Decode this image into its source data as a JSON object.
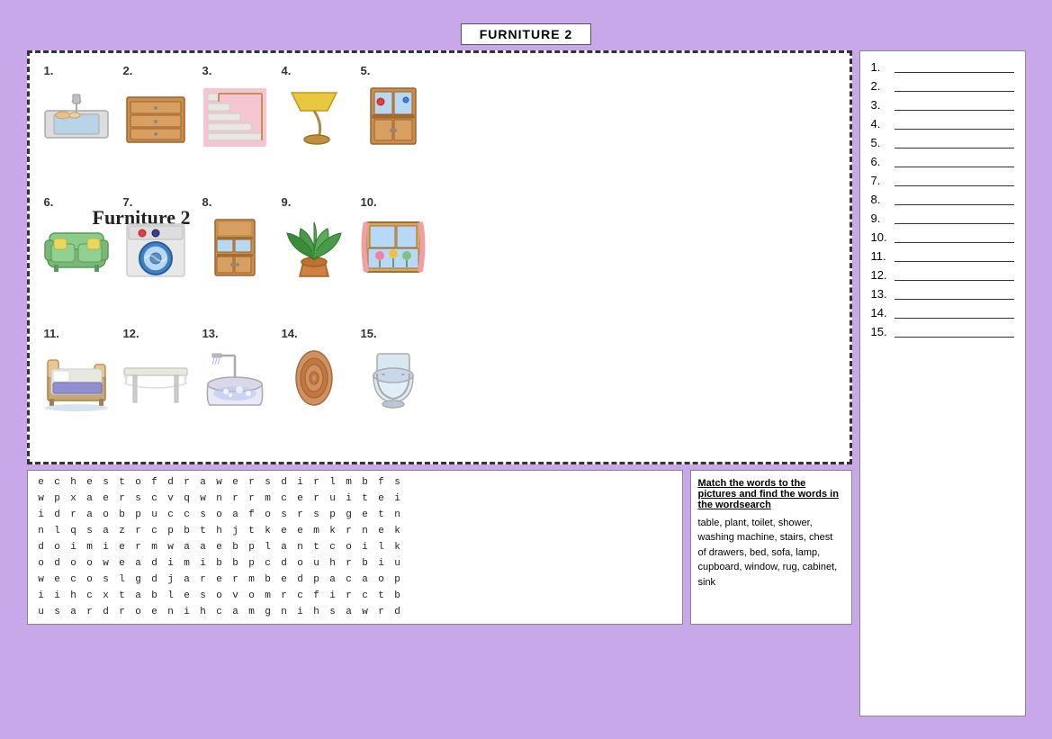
{
  "title": "FURNITURE 2",
  "worksheet_title": "Furniture 2",
  "items": [
    {
      "number": "1.",
      "name": "sink",
      "emoji": "🚿"
    },
    {
      "number": "2.",
      "name": "chest of drawers",
      "emoji": "🗄"
    },
    {
      "number": "3.",
      "name": "stairs",
      "emoji": "🪜"
    },
    {
      "number": "4.",
      "name": "lamp",
      "emoji": "💡"
    },
    {
      "number": "5.",
      "name": "cabinet",
      "emoji": "🗃"
    },
    {
      "number": "6.",
      "name": "sofa",
      "emoji": "🛋"
    },
    {
      "number": "7.",
      "name": "washing machine",
      "emoji": "🫧"
    },
    {
      "number": "8.",
      "name": "cupboard",
      "emoji": "🚪"
    },
    {
      "number": "9.",
      "name": "plant",
      "emoji": "🌿"
    },
    {
      "number": "10.",
      "name": "window",
      "emoji": "🪟"
    },
    {
      "number": "11.",
      "name": "bed",
      "emoji": "🛏"
    },
    {
      "number": "12.",
      "name": "table",
      "emoji": "🪑"
    },
    {
      "number": "13.",
      "name": "shower",
      "emoji": "🚿"
    },
    {
      "number": "14.",
      "name": "rug",
      "emoji": "🔶"
    },
    {
      "number": "15.",
      "name": "toilet",
      "emoji": "🚽"
    }
  ],
  "answers": [
    {
      "num": "1.",
      "line": ""
    },
    {
      "num": "2.",
      "line": ""
    },
    {
      "num": "3.",
      "line": ""
    },
    {
      "num": "4.",
      "line": ""
    },
    {
      "num": "5.",
      "line": ""
    },
    {
      "num": "6.",
      "line": ""
    },
    {
      "num": "7.",
      "line": ""
    },
    {
      "num": "8.",
      "line": ""
    },
    {
      "num": "9.",
      "line": ""
    },
    {
      "num": "10.",
      "line": ""
    },
    {
      "num": "11.",
      "line": ""
    },
    {
      "num": "12.",
      "line": ""
    },
    {
      "num": "13.",
      "line": ""
    },
    {
      "num": "14.",
      "line": ""
    },
    {
      "num": "15.",
      "line": ""
    }
  ],
  "wordsearch": {
    "rows": [
      [
        "e",
        "c",
        "h",
        "e",
        "s",
        "t",
        "o",
        "f",
        "d",
        "r",
        "a",
        "w",
        "e",
        "r",
        "s",
        "d",
        "i",
        "r",
        "l",
        "m",
        "b",
        "f",
        "s"
      ],
      [
        "w",
        "p",
        "x",
        "a",
        "e",
        "r",
        "s",
        "c",
        "v",
        "q",
        "w",
        "n",
        "r",
        "r",
        "m",
        "c",
        "e",
        "r",
        "u",
        "i",
        "t",
        "e",
        "i"
      ],
      [
        "i",
        "d",
        "r",
        "a",
        "o",
        "b",
        "p",
        "u",
        "c",
        "c",
        "s",
        "o",
        "a",
        "f",
        "o",
        "s",
        "r",
        "s",
        "p",
        "g",
        "e",
        "t",
        "n"
      ],
      [
        "n",
        "l",
        "q",
        "s",
        "a",
        "z",
        "r",
        "c",
        "p",
        "b",
        "t",
        "h",
        "j",
        "t",
        "k",
        "e",
        "e",
        "m",
        "k",
        "r",
        "n",
        "e",
        "k"
      ],
      [
        "d",
        "o",
        "i",
        "m",
        "i",
        "e",
        "r",
        "m",
        "w",
        "a",
        "a",
        "e",
        "b",
        "p",
        "l",
        "a",
        "n",
        "t",
        "c",
        "o",
        "i",
        "l",
        "k"
      ],
      [
        "o",
        "d",
        "o",
        "o",
        "w",
        "e",
        "a",
        "d",
        "i",
        "m",
        "i",
        "b",
        "b",
        "p",
        "c",
        "d",
        "o",
        "u",
        "h",
        "r",
        "b",
        "i",
        "u"
      ],
      [
        "w",
        "e",
        "c",
        "o",
        "s",
        "l",
        "g",
        "d",
        "j",
        "a",
        "r",
        "e",
        "r",
        "m",
        "b",
        "e",
        "d",
        "p",
        "a",
        "c",
        "a",
        "o",
        "p"
      ],
      [
        "i",
        "i",
        "h",
        "c",
        "x",
        "t",
        "a",
        "b",
        "l",
        "e",
        "s",
        "o",
        "v",
        "o",
        "m",
        "r",
        "c",
        "f",
        "i",
        "r",
        "c",
        "t",
        "b"
      ],
      [
        "u",
        "s",
        "a",
        "r",
        "d",
        "r",
        "o",
        "e",
        "n",
        "i",
        "h",
        "c",
        "a",
        "m",
        "g",
        "n",
        "i",
        "h",
        "s",
        "a",
        "w",
        "r",
        "d"
      ]
    ]
  },
  "instructions": {
    "title": "Match the words to the pictures and find the words in the wordsearch",
    "words": "table, plant, toilet, shower, washing machine, stairs, chest of drawers, bed, sofa, lamp, cupboard, window, rug, cabinet, sink"
  }
}
